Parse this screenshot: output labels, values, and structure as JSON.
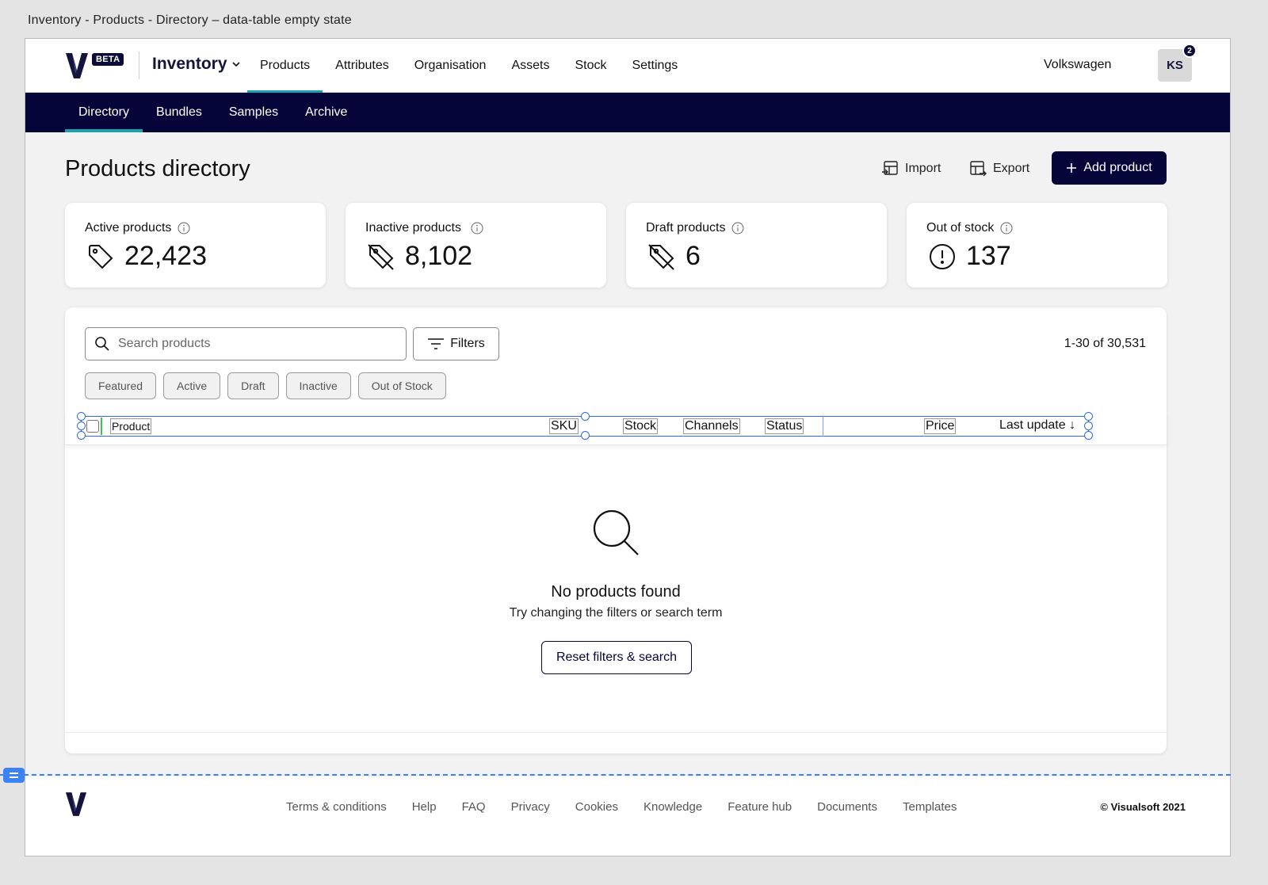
{
  "caption": "Inventory - Products - Directory – data-table empty state",
  "topnav": {
    "beta": "BETA",
    "app_name": "Inventory",
    "links": [
      "Products",
      "Attributes",
      "Organisation",
      "Assets",
      "Stock",
      "Settings"
    ],
    "active": "Products",
    "company": "Volkswagen",
    "avatar": "KS",
    "notification_count": "2"
  },
  "subnav": {
    "links": [
      "Directory",
      "Bundles",
      "Samples",
      "Archive"
    ],
    "active": "Directory"
  },
  "page": {
    "title": "Products directory",
    "import_label": "Import",
    "export_label": "Export",
    "add_label": "Add product"
  },
  "stats": [
    {
      "label": "Active products",
      "value": "22,423",
      "icon": "tag-icon"
    },
    {
      "label": "Inactive products",
      "value": "8,102",
      "icon": "tag-off-icon"
    },
    {
      "label": "Draft products",
      "value": "6",
      "icon": "tag-off-icon"
    },
    {
      "label": "Out of stock",
      "value": "137",
      "icon": "alert-circle-icon"
    }
  ],
  "table": {
    "search_placeholder": "Search products",
    "filters_label": "Filters",
    "count": "1-30 of 30,531",
    "chips": [
      "Featured",
      "Active",
      "Draft",
      "Inactive",
      "Out of Stock"
    ],
    "columns": {
      "product": "Product",
      "sku": "SKU",
      "stock": "Stock",
      "channels": "Channels",
      "status": "Status",
      "price": "Price",
      "last_update": "Last update ↓"
    },
    "empty_title": "No products found",
    "empty_sub": "Try changing the filters or search term",
    "reset_label": "Reset filters & search"
  },
  "footer": {
    "links": [
      "Terms & conditions",
      "Help",
      "FAQ",
      "Privacy",
      "Cookies",
      "Knowledge",
      "Feature hub",
      "Documents",
      "Templates"
    ],
    "copyright": "© Visualsoft 2021"
  },
  "colors": {
    "navy": "#05053a",
    "accent": "#1ba3ad",
    "selection": "#2f6be6"
  }
}
